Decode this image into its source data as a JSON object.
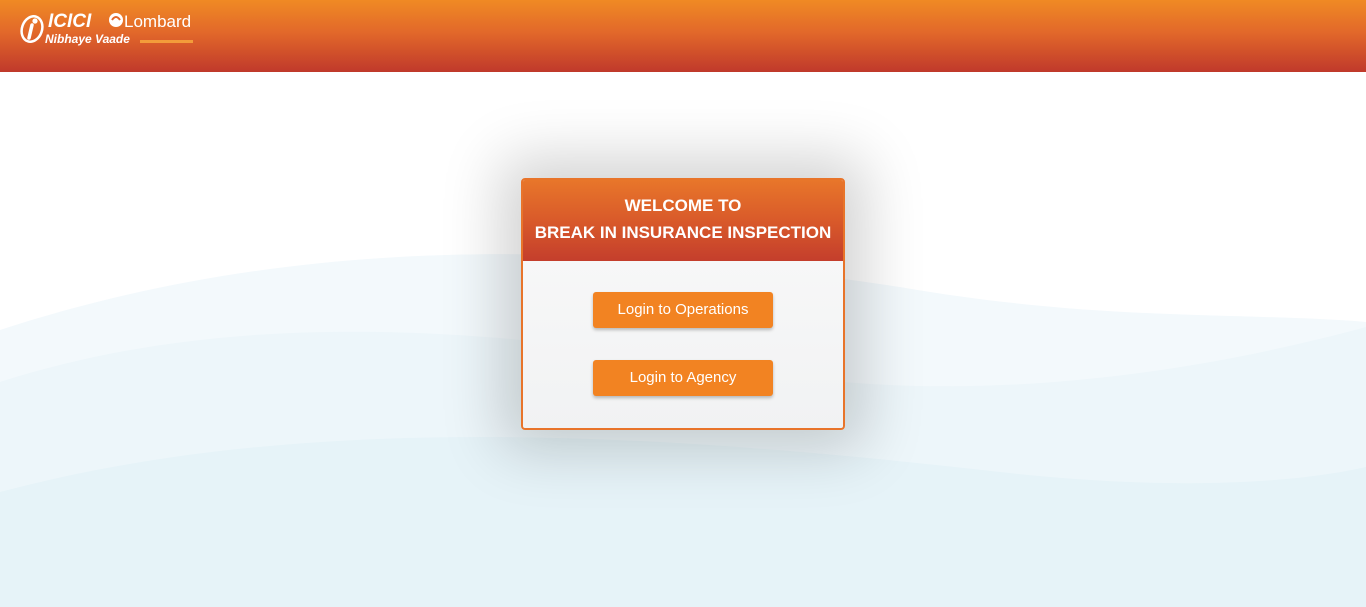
{
  "header": {
    "brand_primary": "ICICI",
    "brand_secondary": "Lombard",
    "tagline": "Nibhaye Vaade",
    "logo_icon": "icici-i-logo-icon",
    "colors": {
      "top": "#f08a24",
      "bottom": "#c0392b"
    }
  },
  "card": {
    "title_line1": "WELCOME TO",
    "title_line2": "BREAK IN INSURANCE INSPECTION",
    "colors": {
      "accent": "#e8742a",
      "button": "#f28322"
    }
  },
  "actions": {
    "operations_label": "Login to Operations",
    "agency_label": "Login to Agency"
  }
}
